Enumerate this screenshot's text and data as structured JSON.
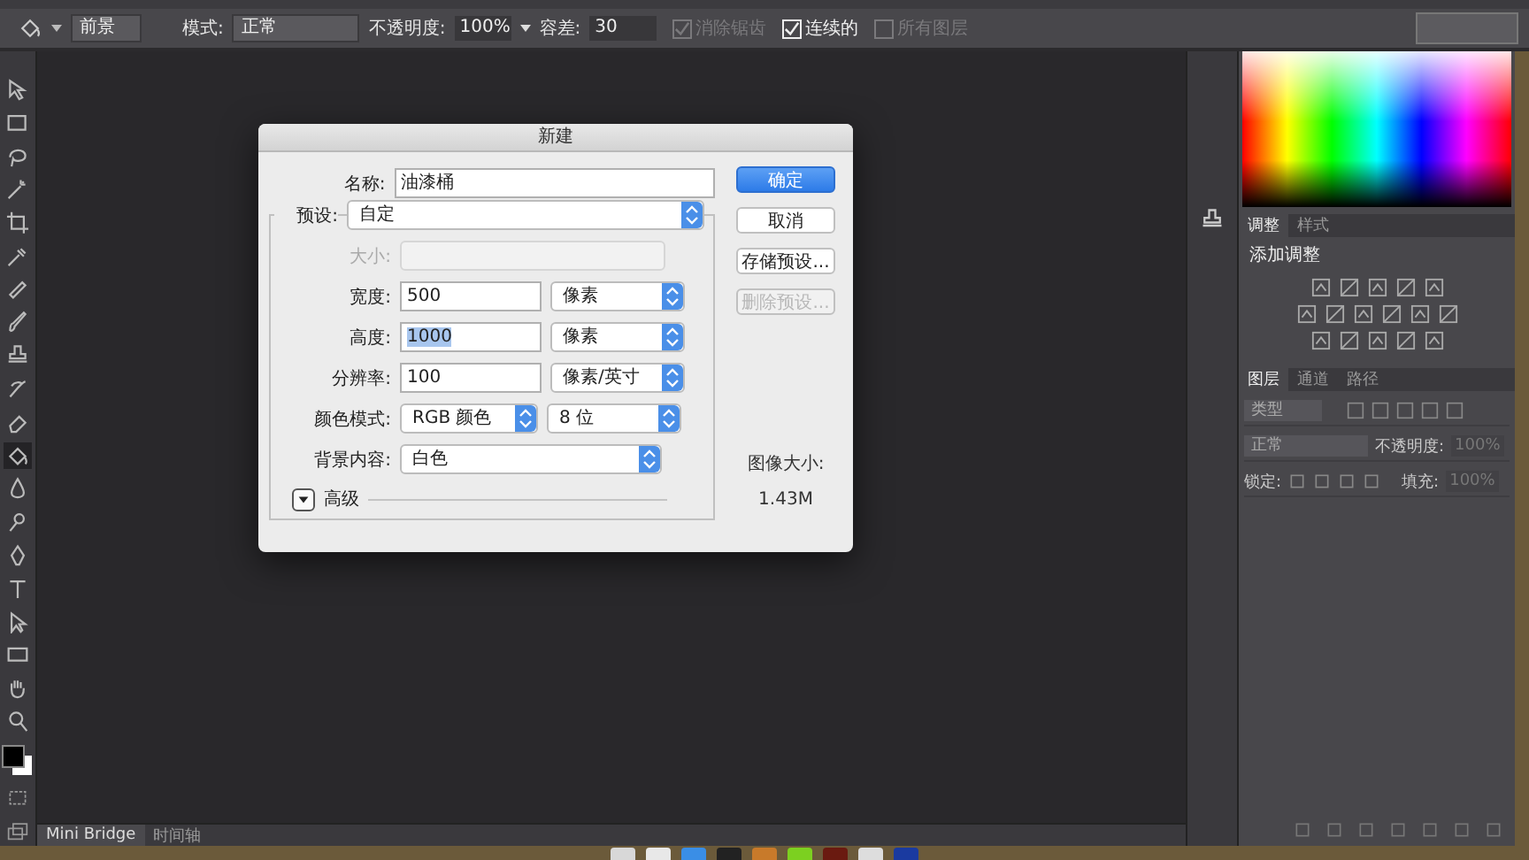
{
  "toolbar": {
    "preset": "前景",
    "mode_label": "模式:",
    "mode": "正常",
    "opacity_label": "不透明度:",
    "opacity": "100%",
    "tolerance_label": "容差:",
    "tolerance": "30",
    "options": [
      {
        "label": "消除锯齿",
        "checked": true,
        "disabled": true
      },
      {
        "label": "连续的",
        "checked": true,
        "disabled": false
      },
      {
        "label": "所有图层",
        "checked": false,
        "disabled": true
      }
    ]
  },
  "tools": [
    {
      "selected": false
    },
    {
      "selected": false
    },
    {
      "selected": false
    },
    {
      "selected": false
    },
    {
      "selected": false
    },
    {
      "selected": false
    },
    {
      "selected": false
    },
    {
      "selected": false
    },
    {
      "selected": false
    },
    {
      "selected": false
    },
    {
      "selected": false
    },
    {
      "selected": true
    },
    {
      "selected": false
    },
    {
      "selected": false
    },
    {
      "selected": false
    },
    {
      "selected": false
    },
    {
      "selected": false
    },
    {
      "selected": false
    },
    {
      "selected": false
    },
    {
      "selected": false
    }
  ],
  "dialog": {
    "title": "新建",
    "name_label": "名称:",
    "name": "油漆桶",
    "preset_label": "预设:",
    "preset": "自定",
    "size_label": "大小:",
    "size_disabled": true,
    "fields": [
      {
        "label": "宽度:",
        "value": "500",
        "unit": "像素",
        "selected": false
      },
      {
        "label": "高度:",
        "value": "1000",
        "unit": "像素",
        "selected": true
      },
      {
        "label": "分辨率:",
        "value": "100",
        "unit": "像素/英寸",
        "selected": false
      }
    ],
    "color_mode_label": "颜色模式:",
    "color_mode": "RGB 颜色",
    "bit_depth": "8 位",
    "background_label": "背景内容:",
    "background": "白色",
    "advanced_label": "高级",
    "advanced_expanded": false,
    "buttons": [
      {
        "label": "确定",
        "kind": "primary",
        "disabled": false
      },
      {
        "label": "取消",
        "kind": "normal",
        "disabled": false
      },
      {
        "label": "存储预设...",
        "kind": "normal",
        "disabled": false
      },
      {
        "label": "删除预设...",
        "kind": "normal",
        "disabled": true
      }
    ],
    "image_size_label": "图像大小:",
    "image_size": "1.43M"
  },
  "panels": {
    "adjust_tabs": [
      {
        "label": "调整",
        "selected": true
      },
      {
        "label": "样式",
        "selected": false
      }
    ],
    "adjust_title": "添加调整",
    "layer_tabs": [
      {
        "label": "图层",
        "selected": true
      },
      {
        "label": "通道",
        "selected": false
      },
      {
        "label": "路径",
        "selected": false
      }
    ],
    "filter": "类型",
    "blend": "正常",
    "opacity_label": "不透明度:",
    "opacity": "100%",
    "lock_label": "锁定:",
    "fill_label": "填充:",
    "fill": "100%"
  },
  "bottom_tabs": [
    {
      "label": "Mini Bridge",
      "selected": true
    },
    {
      "label": "时间轴",
      "selected": false
    }
  ]
}
